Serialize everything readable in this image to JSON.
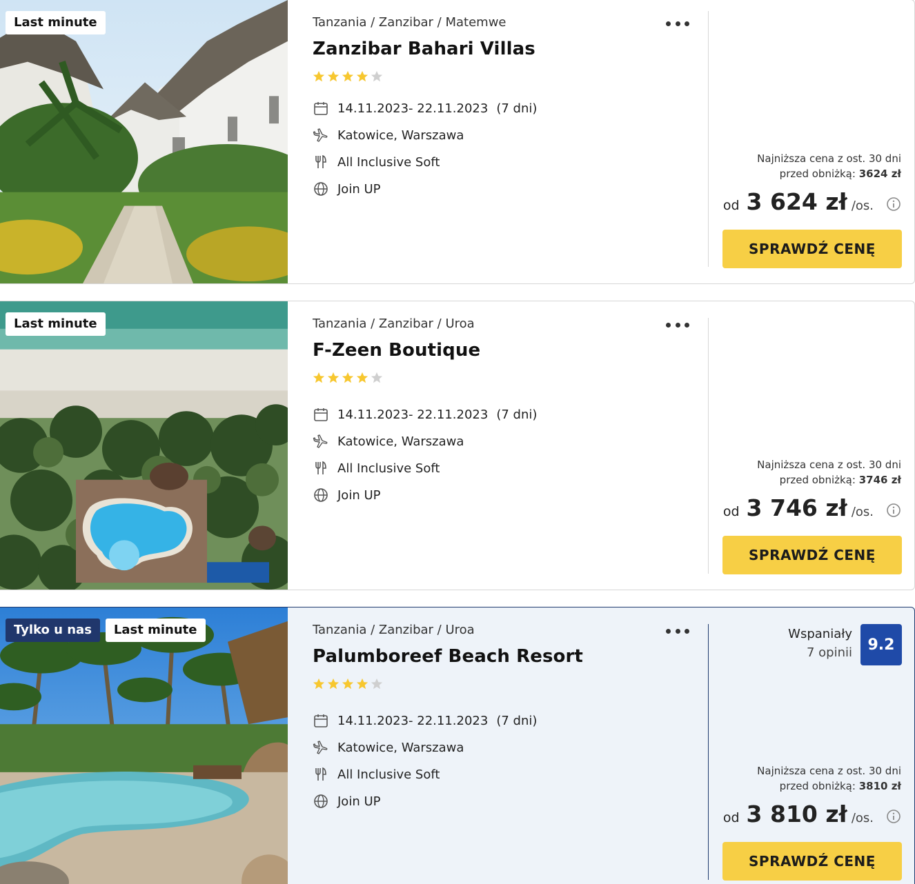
{
  "colors": {
    "accent_yellow": "#f7cf45",
    "badge_dark": "#20376c",
    "score_blue": "#1f4aa8",
    "highlight_bg": "#eef3f9",
    "star_gold": "#f7c72f",
    "star_gray": "#cfcfcf"
  },
  "icons": [
    "heart-icon",
    "more-icon",
    "star-icon",
    "calendar-icon",
    "plane-icon",
    "cutlery-icon",
    "globe-icon",
    "info-icon"
  ],
  "offers": [
    {
      "badges": [
        "Last minute"
      ],
      "location": "Tanzania / Zanzibar / Matemwe",
      "name": "Zanzibar Bahari Villas",
      "stars_filled": 4,
      "stars_total": 5,
      "dates": "14.11.2023- 22.11.2023",
      "duration": "(7 dni)",
      "departures": "Katowice, Warszawa",
      "board": "All Inclusive Soft",
      "operator": "Join UP",
      "lowest_price_line1": "Najniższa cena z ost. 30 dni",
      "lowest_price_prefix": "przed obniżką:",
      "lowest_price_value": "3624 zł",
      "price_from": "od",
      "price": "3 624 zł",
      "price_per": "/os.",
      "cta": "SPRAWDŹ CENĘ"
    },
    {
      "badges": [
        "Last minute"
      ],
      "location": "Tanzania / Zanzibar / Uroa",
      "name": "F-Zeen Boutique",
      "stars_filled": 4,
      "stars_total": 5,
      "dates": "14.11.2023- 22.11.2023",
      "duration": "(7 dni)",
      "departures": "Katowice, Warszawa",
      "board": "All Inclusive Soft",
      "operator": "Join UP",
      "lowest_price_line1": "Najniższa cena z ost. 30 dni",
      "lowest_price_prefix": "przed obniżką:",
      "lowest_price_value": "3746 zł",
      "price_from": "od",
      "price": "3 746 zł",
      "price_per": "/os.",
      "cta": "SPRAWDŹ CENĘ"
    },
    {
      "badges": [
        "Tylko u nas",
        "Last minute"
      ],
      "location": "Tanzania / Zanzibar / Uroa",
      "name": "Palumboreef Beach Resort",
      "stars_filled": 4,
      "stars_total": 5,
      "dates": "14.11.2023- 22.11.2023",
      "duration": "(7 dni)",
      "departures": "Katowice, Warszawa",
      "board": "All Inclusive Soft",
      "operator": "Join UP",
      "rating_label": "Wspaniały",
      "rating_count": "7 opinii",
      "rating_score": "9.2",
      "lowest_price_line1": "Najniższa cena z ost. 30 dni",
      "lowest_price_prefix": "przed obniżką:",
      "lowest_price_value": "3810 zł",
      "price_from": "od",
      "price": "3 810 zł",
      "price_per": "/os.",
      "cta": "SPRAWDŹ CENĘ"
    }
  ]
}
